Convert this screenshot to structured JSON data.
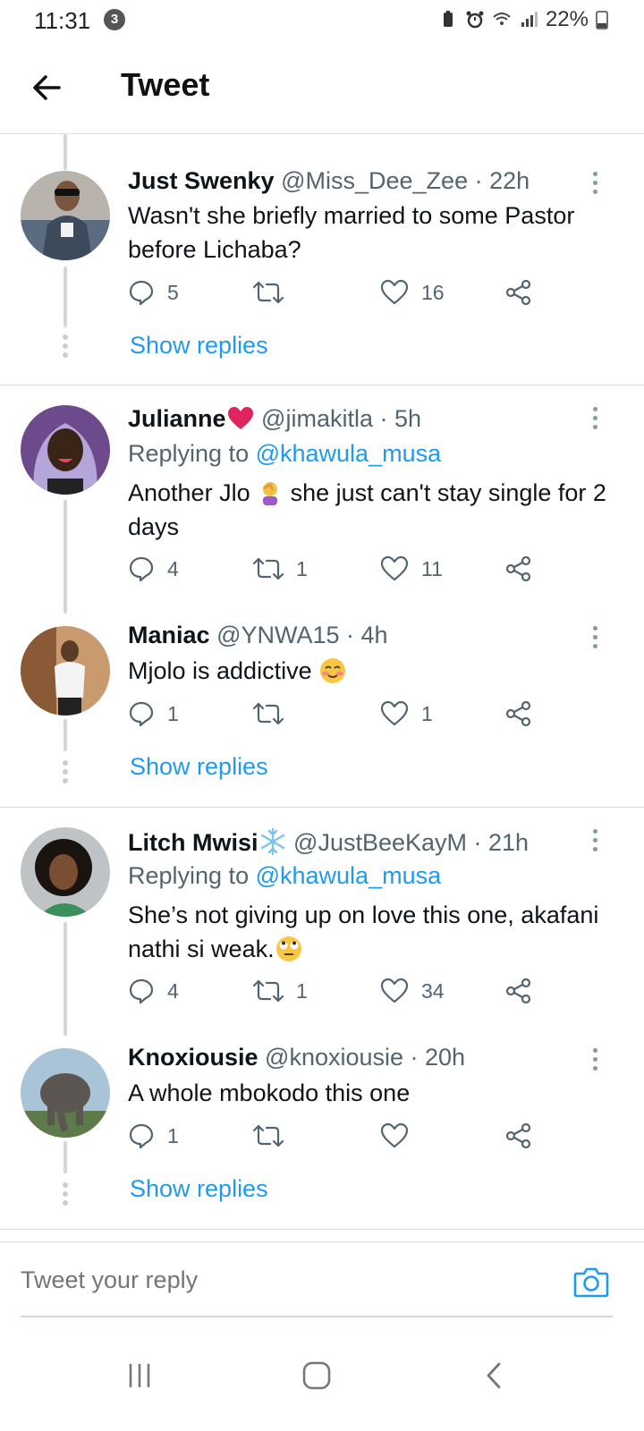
{
  "status_bar": {
    "time": "11:31",
    "notification_count": "3",
    "battery": "22%"
  },
  "header": {
    "title": "Tweet"
  },
  "tweets": [
    {
      "name": "Just Swenky",
      "handle_time": "@Miss_Dee_Zee · 22h",
      "reply_label": "",
      "reply_mention": "",
      "text": "Wasn't she briefly married to some Pastor before Lichaba?",
      "replies": "5",
      "retweets": "",
      "likes": "16",
      "show_replies": "Show replies"
    },
    {
      "name": "Julianne",
      "handle_time": "@jimakitla · 5h",
      "reply_label": "Replying to ",
      "reply_mention": "@khawula_musa",
      "text_before_emoji": "Another Jlo ",
      "text_after_emoji": " she just can't stay single for 2 days",
      "replies": "4",
      "retweets": "1",
      "likes": "11"
    },
    {
      "name": "Maniac",
      "handle_time": "@YNWA15 · 4h",
      "text": "Mjolo is addictive ",
      "replies": "1",
      "retweets": "",
      "likes": "1",
      "show_replies": "Show replies"
    },
    {
      "name": "Litch Mwisi",
      "handle_time": "@JustBeeKayM · 21h",
      "reply_label": "Replying to ",
      "reply_mention": "@khawula_musa",
      "text": "She’s not giving up on love this one, akafani nathi si weak.",
      "replies": "4",
      "retweets": "1",
      "likes": "34"
    },
    {
      "name": "Knoxiousie",
      "handle_time": "@knoxiousie · 20h",
      "text": "A whole mbokodo this one",
      "replies": "1",
      "retweets": "",
      "likes": "",
      "show_replies": "Show replies"
    }
  ],
  "reply_bar": {
    "placeholder": "Tweet your reply"
  },
  "icons": {
    "back": "arrow-left-icon",
    "reply": "comment-icon",
    "retweet": "retweet-icon",
    "like": "heart-icon",
    "share": "share-icon",
    "more": "more-vertical-icon",
    "camera": "camera-icon"
  },
  "colors": {
    "link": "#1d9bf0",
    "secondary_text": "#536471",
    "divider": "#dcdfe2",
    "heart_red": "#e0245e"
  }
}
